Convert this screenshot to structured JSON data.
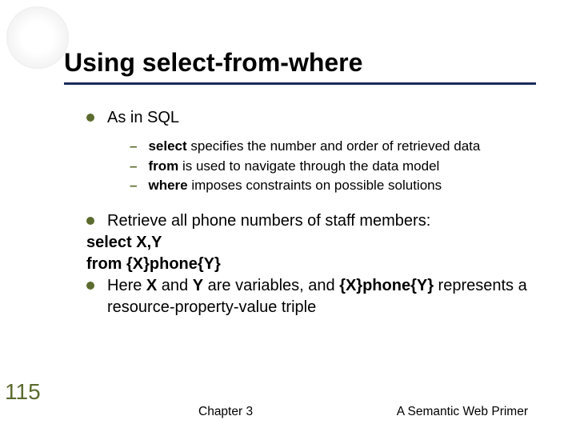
{
  "title": "Using select-from-where",
  "point1": "As in SQL",
  "sub1": {
    "kw": "select",
    "rest": " specifies the number and order of retrieved data"
  },
  "sub2": {
    "kw": "from",
    "rest": " is used to navigate through the data model"
  },
  "sub3": {
    "kw": "where",
    "rest": " imposes constraints on possible solutions"
  },
  "point2": "Retrieve all phone numbers of staff members:",
  "code1": "select X,Y",
  "code2": "from {X}phone{Y}",
  "point3_a": "Here ",
  "point3_b": "X",
  "point3_c": " and ",
  "point3_d": "Y",
  "point3_e": " are variables, and ",
  "point3_f": "{X}phone{Y}",
  "point3_g": " represents a resource-property-value triple",
  "page_num": "115",
  "footer_center": "Chapter 3",
  "footer_right": "A Semantic Web Primer"
}
